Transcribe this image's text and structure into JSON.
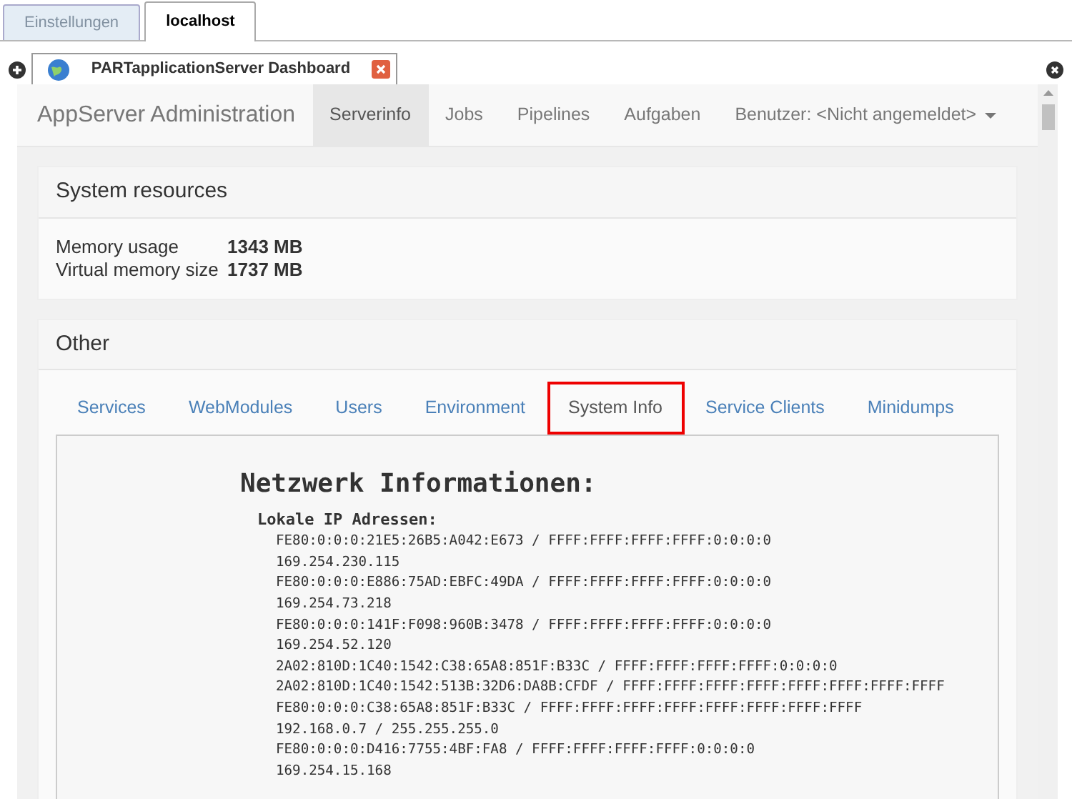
{
  "window_tabs": [
    {
      "label": "Einstellungen",
      "selected": false
    },
    {
      "label": "localhost",
      "selected": true
    }
  ],
  "document_tab": {
    "title": "PARTapplicationServer Dashboard"
  },
  "navbar": {
    "brand": "AppServer Administration",
    "items": [
      {
        "label": "Serverinfo",
        "selected": true
      },
      {
        "label": "Jobs",
        "selected": false
      },
      {
        "label": "Pipelines",
        "selected": false
      },
      {
        "label": "Aufgaben",
        "selected": false
      }
    ],
    "user_menu": "Benutzer: <Nicht angemeldet>"
  },
  "system_resources": {
    "title": "System resources",
    "rows": [
      {
        "label": "Memory usage",
        "value": "1343 MB"
      },
      {
        "label": "Virtual memory size",
        "value": "1737 MB"
      }
    ]
  },
  "other": {
    "title": "Other",
    "tabs": [
      {
        "label": "Services",
        "selected": false
      },
      {
        "label": "WebModules",
        "selected": false
      },
      {
        "label": "Users",
        "selected": false
      },
      {
        "label": "Environment",
        "selected": false
      },
      {
        "label": "System Info",
        "selected": true
      },
      {
        "label": "Service Clients",
        "selected": false
      },
      {
        "label": "Minidumps",
        "selected": false
      }
    ],
    "heading": "Netzwerk Informationen:",
    "subheading": "Lokale IP Adressen:",
    "lines": [
      "FE80:0:0:0:21E5:26B5:A042:E673 / FFFF:FFFF:FFFF:FFFF:0:0:0:0",
      "169.254.230.115",
      "FE80:0:0:0:E886:75AD:EBFC:49DA / FFFF:FFFF:FFFF:FFFF:0:0:0:0",
      "169.254.73.218",
      "FE80:0:0:0:141F:F098:960B:3478 / FFFF:FFFF:FFFF:FFFF:0:0:0:0",
      "169.254.52.120",
      "2A02:810D:1C40:1542:C38:65A8:851F:B33C / FFFF:FFFF:FFFF:FFFF:0:0:0:0",
      "2A02:810D:1C40:1542:513B:32D6:DA8B:CFDF / FFFF:FFFF:FFFF:FFFF:FFFF:FFFF:FFFF:FFFF",
      "FE80:0:0:0:C38:65A8:851F:B33C / FFFF:FFFF:FFFF:FFFF:FFFF:FFFF:FFFF:FFFF",
      "192.168.0.7 / 255.255.255.0",
      "FE80:0:0:0:D416:7755:4BF:FA8 / FFFF:FFFF:FFFF:FFFF:0:0:0:0",
      "169.254.15.168"
    ]
  }
}
